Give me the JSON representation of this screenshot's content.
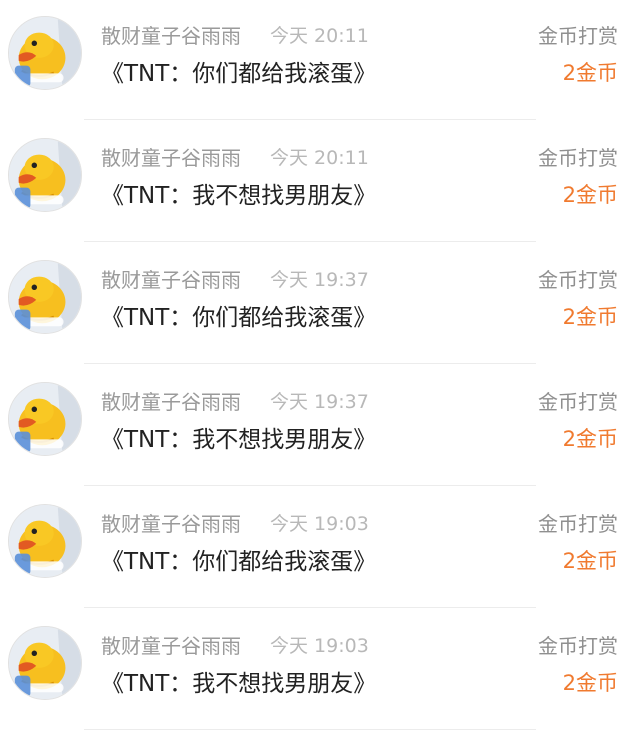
{
  "items": [
    {
      "user": "散财童子谷雨雨",
      "time": "今天 20:11",
      "content": "《TNT：你们都给我滚蛋》",
      "reward_label": "金币打赏",
      "reward_amount": "2金币"
    },
    {
      "user": "散财童子谷雨雨",
      "time": "今天 20:11",
      "content": "《TNT：我不想找男朋友》",
      "reward_label": "金币打赏",
      "reward_amount": "2金币"
    },
    {
      "user": "散财童子谷雨雨",
      "time": "今天 19:37",
      "content": "《TNT：你们都给我滚蛋》",
      "reward_label": "金币打赏",
      "reward_amount": "2金币"
    },
    {
      "user": "散财童子谷雨雨",
      "time": "今天 19:37",
      "content": "《TNT：我不想找男朋友》",
      "reward_label": "金币打赏",
      "reward_amount": "2金币"
    },
    {
      "user": "散财童子谷雨雨",
      "time": "今天 19:03",
      "content": "《TNT：你们都给我滚蛋》",
      "reward_label": "金币打赏",
      "reward_amount": "2金币"
    },
    {
      "user": "散财童子谷雨雨",
      "time": "今天 19:03",
      "content": "《TNT：我不想找男朋友》",
      "reward_label": "金币打赏",
      "reward_amount": "2金币"
    }
  ],
  "colors": {
    "reward_amount": "#f07a2f",
    "username": "#9a9a9a",
    "timestamp": "#b8b8b8",
    "content": "#222222",
    "separator": "#ececec"
  },
  "icons": {
    "avatar": "duck-avatar-icon"
  }
}
